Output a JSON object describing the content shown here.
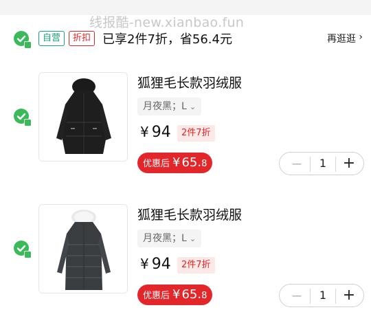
{
  "watermark": "线报酷-new.xianbao.fun",
  "store": {
    "badge_self": "自营",
    "badge_discount": "折扣",
    "promo_text": "已享2件7折，省56.4元",
    "more_link": "再逛逛",
    "more_chevron": "›"
  },
  "items": [
    {
      "title": "狐狸毛长款羽绒服",
      "variant": "月夜黑；L",
      "variant_chevron": "⌄",
      "price_symbol": "¥",
      "price": "94",
      "discount_tag": "2件7折",
      "after_label": "优惠后",
      "after_symbol": "¥",
      "after_amount": "65.",
      "after_decimal": "8",
      "minus": "−",
      "quantity": "1",
      "plus": "+"
    },
    {
      "title": "狐狸毛长款羽绒服",
      "variant": "月夜黑；L",
      "variant_chevron": "⌄",
      "price_symbol": "¥",
      "price": "94",
      "discount_tag": "2件7折",
      "after_label": "优惠后",
      "after_symbol": "¥",
      "after_amount": "65.",
      "after_decimal": "8",
      "minus": "−",
      "quantity": "1",
      "plus": "+"
    }
  ],
  "colors": {
    "check_green": "#3aba58",
    "self_badge": "#1aa37a",
    "accent_red": "#e3262a"
  }
}
